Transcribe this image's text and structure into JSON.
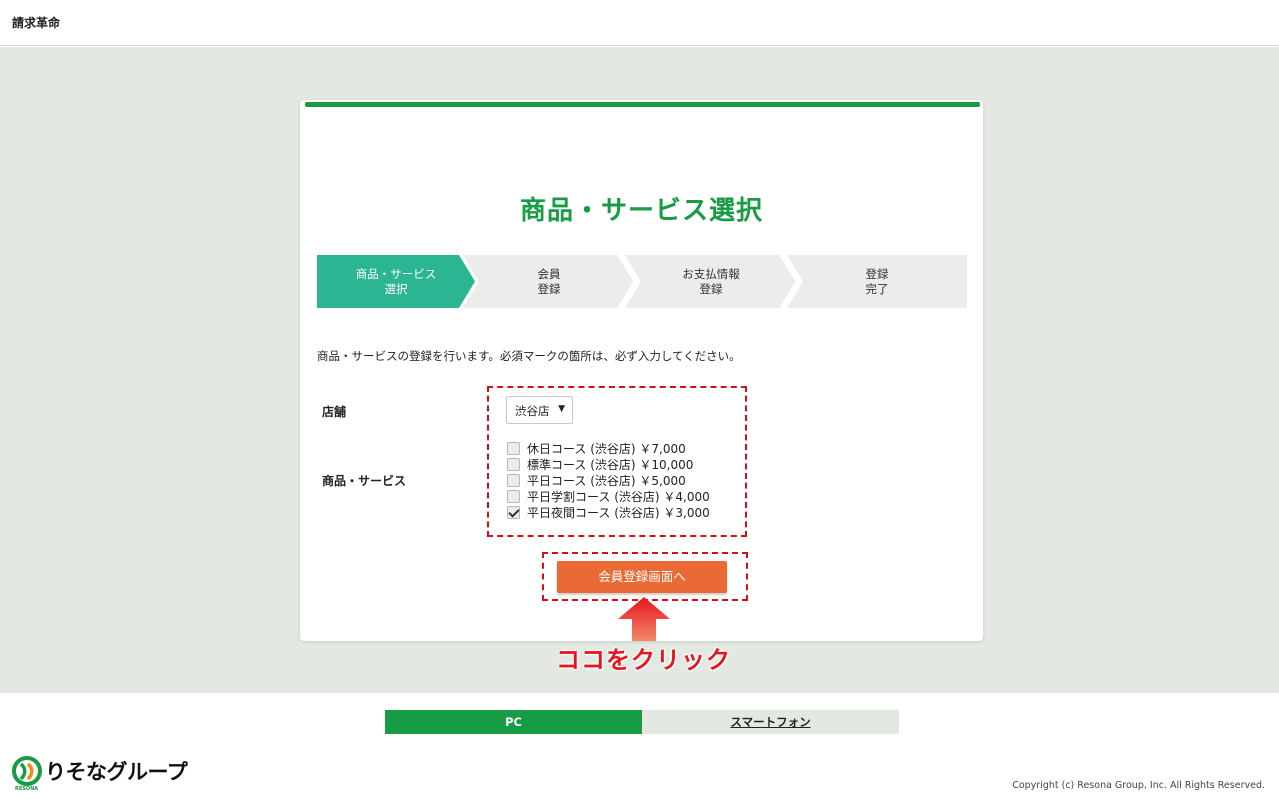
{
  "header": {
    "brand": "請求革命"
  },
  "card": {
    "title": "商品・サービス選択",
    "steps": [
      {
        "label": "商品・サービス\n選択",
        "state": "active"
      },
      {
        "label": "会員\n登録",
        "state": "inactive"
      },
      {
        "label": "お支払情報\n登録",
        "state": "inactive"
      },
      {
        "label": "登録\n完了",
        "state": "inactive"
      }
    ],
    "lead": "商品・サービスの登録を行います。必須マークの箇所は、必ず入力してください。",
    "store_label": "店舗",
    "store_value": "渋谷店",
    "service_label": "商品・サービス",
    "services": [
      {
        "label": "休日コース (渋谷店) ￥7,000",
        "checked": false
      },
      {
        "label": "標準コース (渋谷店) ￥10,000",
        "checked": false
      },
      {
        "label": "平日コース (渋谷店) ￥5,000",
        "checked": false
      },
      {
        "label": "平日学割コース (渋谷店) ￥4,000",
        "checked": false
      },
      {
        "label": "平日夜間コース (渋谷店) ￥3,000",
        "checked": true
      }
    ],
    "submit_label": "会員登録画面へ"
  },
  "annotation": {
    "callout": "ココをクリック"
  },
  "footer": {
    "view_pc": "PC",
    "view_sp": "スマートフォン",
    "logo_text": "りそなグループ",
    "logo_sub": "RESONA",
    "copyright": "Copyright (c) Resona Group, Inc. All Rights Reserved."
  },
  "colors": {
    "brand_green": "#179b45",
    "step_active": "#2cb593",
    "step_inactive": "#ececec",
    "cta_orange": "#e96a35",
    "annotation_red": "#d40f1a"
  }
}
